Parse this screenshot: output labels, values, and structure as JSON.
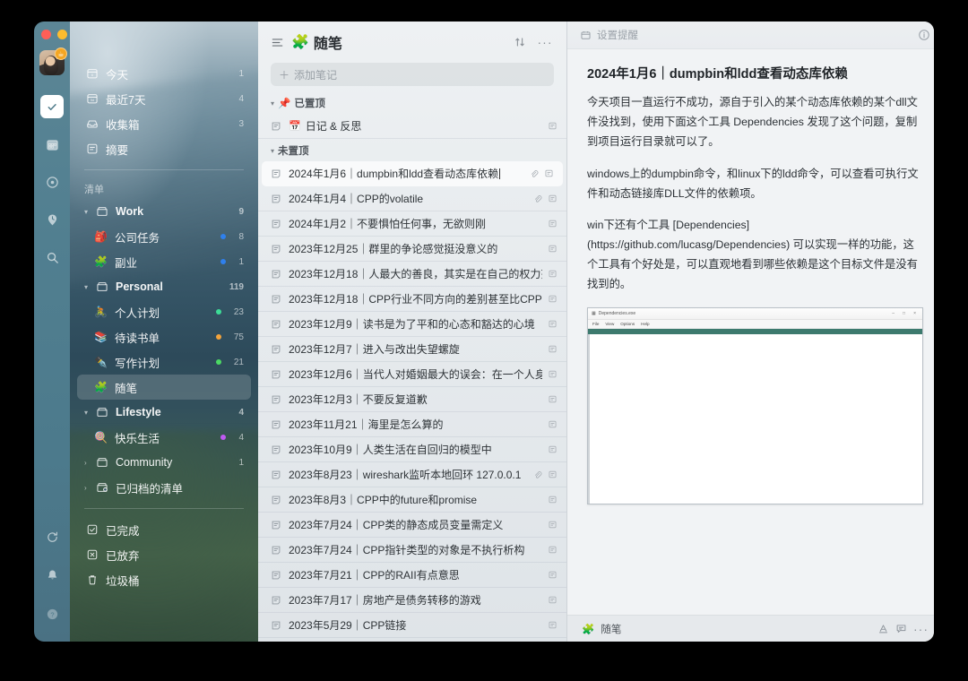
{
  "window": {
    "traffic_lights": [
      "close",
      "minimize",
      "zoom"
    ],
    "avatar_badge": "☕"
  },
  "rail": {
    "items": [
      {
        "name": "tasks",
        "icon": "check-square-icon",
        "active": true
      },
      {
        "name": "calendar",
        "icon": "calendar-icon",
        "active": false
      },
      {
        "name": "focus",
        "icon": "target-icon",
        "active": false
      },
      {
        "name": "habit",
        "icon": "clock-pin-icon",
        "active": false
      },
      {
        "name": "search",
        "icon": "search-icon",
        "active": false
      }
    ],
    "bottom_items": [
      {
        "name": "sync",
        "icon": "refresh-icon"
      },
      {
        "name": "notifications",
        "icon": "bell-icon"
      },
      {
        "name": "help",
        "icon": "question-circle-icon"
      }
    ]
  },
  "sidebar": {
    "smart_lists": [
      {
        "label": "今天",
        "icon": "calendar-today-icon",
        "count": "1"
      },
      {
        "label": "最近7天",
        "icon": "calendar-week-icon",
        "count": "4"
      },
      {
        "label": "收集箱",
        "icon": "inbox-icon",
        "count": "3"
      },
      {
        "label": "摘要",
        "icon": "summary-icon",
        "count": ""
      }
    ],
    "section_title": "清单",
    "lists": [
      {
        "label": "Work",
        "type": "group",
        "icon": "folder-icon",
        "count": "9",
        "expanded": true,
        "bullet": "",
        "emoji": ""
      },
      {
        "label": "公司任务",
        "type": "item",
        "emoji": "🎒",
        "count": "8",
        "bullet": "#2f80ed"
      },
      {
        "label": "副业",
        "type": "item",
        "emoji": "🧩",
        "count": "1",
        "bullet": "#2f80ed"
      },
      {
        "label": "Personal",
        "type": "group",
        "icon": "folder-icon",
        "count": "119",
        "expanded": true,
        "bullet": "",
        "emoji": ""
      },
      {
        "label": "个人计划",
        "type": "item",
        "emoji": "🚴",
        "count": "23",
        "bullet": "#3ddc97"
      },
      {
        "label": "待读书单",
        "type": "item",
        "emoji": "📚",
        "count": "75",
        "bullet": "#f2a33c"
      },
      {
        "label": "写作计划",
        "type": "item",
        "emoji": "✒️",
        "count": "21",
        "bullet": "#4cd964"
      },
      {
        "label": "随笔",
        "type": "item",
        "emoji": "🧩",
        "count": "",
        "bullet": "",
        "selected": true
      },
      {
        "label": "Lifestyle",
        "type": "group",
        "icon": "folder-icon",
        "count": "4",
        "expanded": true,
        "bullet": "",
        "emoji": ""
      },
      {
        "label": "快乐生活",
        "type": "item",
        "emoji": "🍭",
        "count": "4",
        "bullet": "#bf5af2"
      },
      {
        "label": "Community",
        "type": "group",
        "icon": "folder-icon",
        "count": "1",
        "expanded": false,
        "bullet": "",
        "emoji": ""
      },
      {
        "label": "已归档的清单",
        "type": "group",
        "icon": "folder-archive-icon",
        "count": "",
        "expanded": false,
        "bullet": "",
        "emoji": ""
      }
    ],
    "footer_items": [
      {
        "label": "已完成",
        "icon": "check-box-icon"
      },
      {
        "label": "已放弃",
        "icon": "x-box-icon"
      },
      {
        "label": "垃圾桶",
        "icon": "trash-icon"
      }
    ]
  },
  "list_column": {
    "menu_icon": "hamburger-icon",
    "title_emoji": "🧩",
    "title": "随笔",
    "sort_icon": "sort-icon",
    "more_icon": "more-icon",
    "add_note_placeholder": "添加笔记",
    "sections": [
      {
        "label": "已置顶",
        "emoji": "📌",
        "notes": [
          {
            "emoji": "📅",
            "text": "日记 & 反思",
            "attachment": false,
            "note_badge": true,
            "highlight": false
          }
        ]
      },
      {
        "label": "未置顶",
        "emoji": "",
        "notes": [
          {
            "text": "2024年1月6｜dumpbin和ldd查看动态库依赖",
            "attachment": true,
            "note_badge": true,
            "highlight": true,
            "caret": true
          },
          {
            "text": "2024年1月4｜CPP的volatile",
            "attachment": true,
            "note_badge": true,
            "highlight": false
          },
          {
            "text": "2024年1月2｜不要惧怕任何事，无欲则刚",
            "attachment": false,
            "note_badge": true,
            "highlight": false
          },
          {
            "text": "2023年12月25｜群里的争论感觉挺没意义的",
            "attachment": false,
            "note_badge": true,
            "highlight": false
          },
          {
            "text": "2023年12月18｜人最大的善良，其实是在自己的权力范围内不为",
            "attachment": false,
            "note_badge": true,
            "highlight": false
          },
          {
            "text": "2023年12月18｜CPP行业不同方向的差别甚至比CPP和JAVA的",
            "attachment": false,
            "note_badge": true,
            "highlight": false
          },
          {
            "text": "2023年12月9｜读书是为了平和的心态和豁达的心境",
            "attachment": false,
            "note_badge": true,
            "highlight": false
          },
          {
            "text": "2023年12月7｜进入与改出失望螺旋",
            "attachment": false,
            "note_badge": true,
            "highlight": false
          },
          {
            "text": "2023年12月6｜当代人对婚姻最大的误会：在一个人身上实现所",
            "attachment": false,
            "note_badge": true,
            "highlight": false
          },
          {
            "text": "2023年12月3｜不要反复道歉",
            "attachment": false,
            "note_badge": true,
            "highlight": false
          },
          {
            "text": "2023年11月21｜海里是怎么算的",
            "attachment": false,
            "note_badge": true,
            "highlight": false
          },
          {
            "text": "2023年10月9｜人类生活在自回归的模型中",
            "attachment": false,
            "note_badge": true,
            "highlight": false
          },
          {
            "text": "2023年8月23｜wireshark监听本地回环 127.0.0.1",
            "attachment": true,
            "note_badge": true,
            "highlight": false
          },
          {
            "text": "2023年8月3｜CPP中的future和promise",
            "attachment": false,
            "note_badge": true,
            "highlight": false
          },
          {
            "text": "2023年7月24｜CPP类的静态成员变量需定义",
            "attachment": false,
            "note_badge": true,
            "highlight": false
          },
          {
            "text": "2023年7月24｜CPP指针类型的对象是不执行析构",
            "attachment": false,
            "note_badge": true,
            "highlight": false
          },
          {
            "text": "2023年7月21｜CPP的RAII有点意思",
            "attachment": false,
            "note_badge": true,
            "highlight": false
          },
          {
            "text": "2023年7月17｜房地产是债务转移的游戏",
            "attachment": false,
            "note_badge": true,
            "highlight": false
          },
          {
            "text": "2023年5月29｜CPP链接",
            "attachment": false,
            "note_badge": true,
            "highlight": false
          }
        ]
      }
    ]
  },
  "detail": {
    "reminder_label": "设置提醒",
    "reminder_icon": "reminder-icon",
    "info_icon": "info-icon",
    "title": "2024年1月6｜dumpbin和ldd查看动态库依赖",
    "paragraphs": [
      "今天项目一直运行不成功，源自于引入的某个动态库依赖的某个dll文件没找到，使用下面这个工具 Dependencies 发现了这个问题，复制到项目运行目录就可以了。",
      "windows上的dumpbin命令，和linux下的ldd命令，可以查看可执行文件和动态链接库DLL文件的依赖项。",
      "win下还有个工具 [Dependencies](https://github.com/lucasg/Dependencies) 可以实现一样的功能，这个工具有个好处是，可以直观地看到哪些依赖是这个目标文件是没有找到的。"
    ],
    "embed": {
      "window_title": "Dependencies.exe",
      "menu": [
        "File",
        "View",
        "Options",
        "Help"
      ],
      "min_label": "–",
      "max_label": "□",
      "close_label": "×",
      "accent_color": "#3d7a6e"
    },
    "footer": {
      "emoji": "🧩",
      "list_name": "随笔",
      "format_icon": "format-text-icon",
      "comment_icon": "comment-icon",
      "more_icon": "more-icon"
    }
  }
}
